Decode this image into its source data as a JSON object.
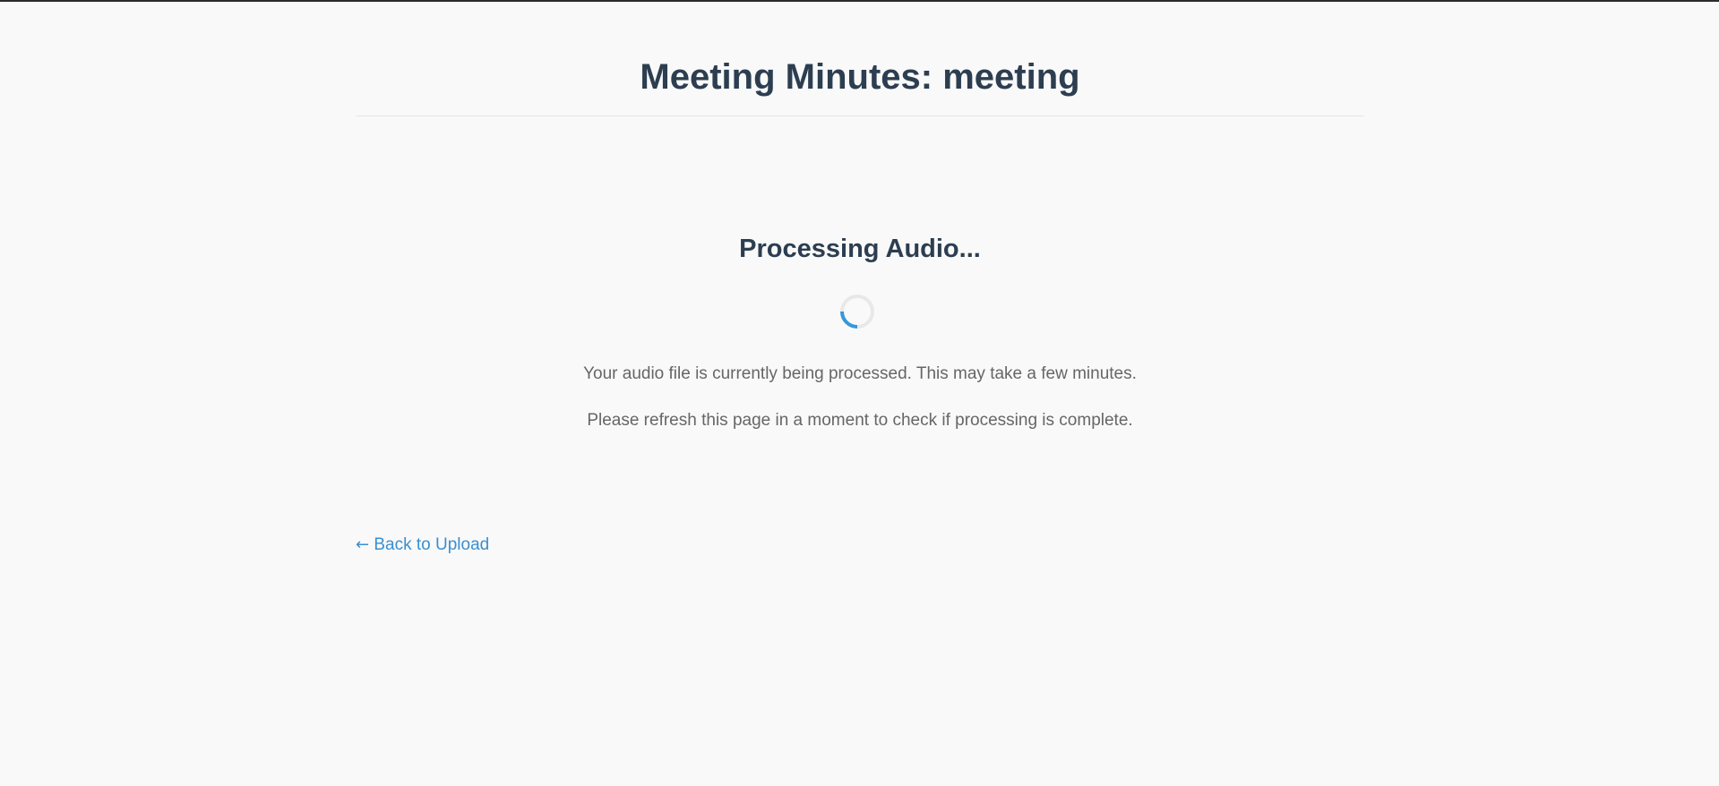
{
  "page": {
    "title": "Meeting Minutes: meeting"
  },
  "processing": {
    "heading": "Processing Audio...",
    "message_1": "Your audio file is currently being processed. This may take a few minutes.",
    "message_2": "Please refresh this page in a moment to check if processing is complete.",
    "spinner_icon": "loading-spinner-icon"
  },
  "navigation": {
    "back_arrow": "←",
    "back_label": "Back to Upload"
  },
  "colors": {
    "background": "#f9f9f9",
    "heading": "#2c3e50",
    "body_text": "#666666",
    "link": "#3a8fd1",
    "spinner_accent": "#3498db",
    "spinner_track": "#e8e8e8"
  }
}
